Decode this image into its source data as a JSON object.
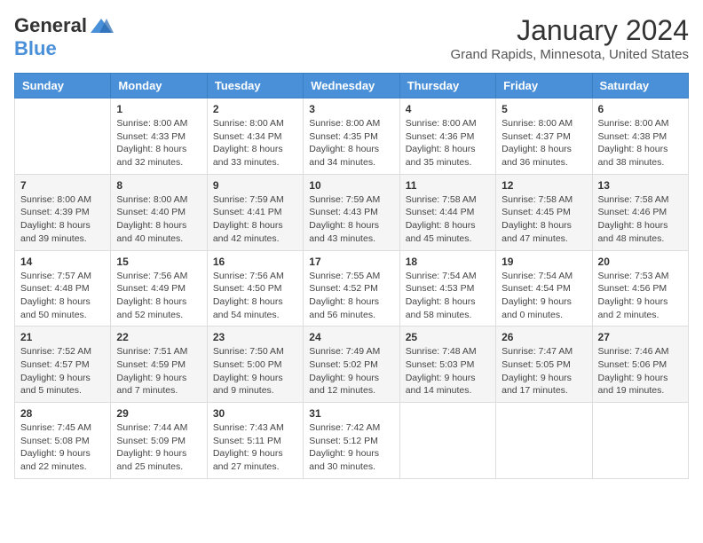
{
  "logo": {
    "general": "General",
    "blue": "Blue"
  },
  "header": {
    "month": "January 2024",
    "location": "Grand Rapids, Minnesota, United States"
  },
  "weekdays": [
    "Sunday",
    "Monday",
    "Tuesday",
    "Wednesday",
    "Thursday",
    "Friday",
    "Saturday"
  ],
  "weeks": [
    [
      {
        "day": "",
        "info": ""
      },
      {
        "day": "1",
        "info": "Sunrise: 8:00 AM\nSunset: 4:33 PM\nDaylight: 8 hours\nand 32 minutes."
      },
      {
        "day": "2",
        "info": "Sunrise: 8:00 AM\nSunset: 4:34 PM\nDaylight: 8 hours\nand 33 minutes."
      },
      {
        "day": "3",
        "info": "Sunrise: 8:00 AM\nSunset: 4:35 PM\nDaylight: 8 hours\nand 34 minutes."
      },
      {
        "day": "4",
        "info": "Sunrise: 8:00 AM\nSunset: 4:36 PM\nDaylight: 8 hours\nand 35 minutes."
      },
      {
        "day": "5",
        "info": "Sunrise: 8:00 AM\nSunset: 4:37 PM\nDaylight: 8 hours\nand 36 minutes."
      },
      {
        "day": "6",
        "info": "Sunrise: 8:00 AM\nSunset: 4:38 PM\nDaylight: 8 hours\nand 38 minutes."
      }
    ],
    [
      {
        "day": "7",
        "info": "Sunrise: 8:00 AM\nSunset: 4:39 PM\nDaylight: 8 hours\nand 39 minutes."
      },
      {
        "day": "8",
        "info": "Sunrise: 8:00 AM\nSunset: 4:40 PM\nDaylight: 8 hours\nand 40 minutes."
      },
      {
        "day": "9",
        "info": "Sunrise: 7:59 AM\nSunset: 4:41 PM\nDaylight: 8 hours\nand 42 minutes."
      },
      {
        "day": "10",
        "info": "Sunrise: 7:59 AM\nSunset: 4:43 PM\nDaylight: 8 hours\nand 43 minutes."
      },
      {
        "day": "11",
        "info": "Sunrise: 7:58 AM\nSunset: 4:44 PM\nDaylight: 8 hours\nand 45 minutes."
      },
      {
        "day": "12",
        "info": "Sunrise: 7:58 AM\nSunset: 4:45 PM\nDaylight: 8 hours\nand 47 minutes."
      },
      {
        "day": "13",
        "info": "Sunrise: 7:58 AM\nSunset: 4:46 PM\nDaylight: 8 hours\nand 48 minutes."
      }
    ],
    [
      {
        "day": "14",
        "info": "Sunrise: 7:57 AM\nSunset: 4:48 PM\nDaylight: 8 hours\nand 50 minutes."
      },
      {
        "day": "15",
        "info": "Sunrise: 7:56 AM\nSunset: 4:49 PM\nDaylight: 8 hours\nand 52 minutes."
      },
      {
        "day": "16",
        "info": "Sunrise: 7:56 AM\nSunset: 4:50 PM\nDaylight: 8 hours\nand 54 minutes."
      },
      {
        "day": "17",
        "info": "Sunrise: 7:55 AM\nSunset: 4:52 PM\nDaylight: 8 hours\nand 56 minutes."
      },
      {
        "day": "18",
        "info": "Sunrise: 7:54 AM\nSunset: 4:53 PM\nDaylight: 8 hours\nand 58 minutes."
      },
      {
        "day": "19",
        "info": "Sunrise: 7:54 AM\nSunset: 4:54 PM\nDaylight: 9 hours\nand 0 minutes."
      },
      {
        "day": "20",
        "info": "Sunrise: 7:53 AM\nSunset: 4:56 PM\nDaylight: 9 hours\nand 2 minutes."
      }
    ],
    [
      {
        "day": "21",
        "info": "Sunrise: 7:52 AM\nSunset: 4:57 PM\nDaylight: 9 hours\nand 5 minutes."
      },
      {
        "day": "22",
        "info": "Sunrise: 7:51 AM\nSunset: 4:59 PM\nDaylight: 9 hours\nand 7 minutes."
      },
      {
        "day": "23",
        "info": "Sunrise: 7:50 AM\nSunset: 5:00 PM\nDaylight: 9 hours\nand 9 minutes."
      },
      {
        "day": "24",
        "info": "Sunrise: 7:49 AM\nSunset: 5:02 PM\nDaylight: 9 hours\nand 12 minutes."
      },
      {
        "day": "25",
        "info": "Sunrise: 7:48 AM\nSunset: 5:03 PM\nDaylight: 9 hours\nand 14 minutes."
      },
      {
        "day": "26",
        "info": "Sunrise: 7:47 AM\nSunset: 5:05 PM\nDaylight: 9 hours\nand 17 minutes."
      },
      {
        "day": "27",
        "info": "Sunrise: 7:46 AM\nSunset: 5:06 PM\nDaylight: 9 hours\nand 19 minutes."
      }
    ],
    [
      {
        "day": "28",
        "info": "Sunrise: 7:45 AM\nSunset: 5:08 PM\nDaylight: 9 hours\nand 22 minutes."
      },
      {
        "day": "29",
        "info": "Sunrise: 7:44 AM\nSunset: 5:09 PM\nDaylight: 9 hours\nand 25 minutes."
      },
      {
        "day": "30",
        "info": "Sunrise: 7:43 AM\nSunset: 5:11 PM\nDaylight: 9 hours\nand 27 minutes."
      },
      {
        "day": "31",
        "info": "Sunrise: 7:42 AM\nSunset: 5:12 PM\nDaylight: 9 hours\nand 30 minutes."
      },
      {
        "day": "",
        "info": ""
      },
      {
        "day": "",
        "info": ""
      },
      {
        "day": "",
        "info": ""
      }
    ]
  ]
}
